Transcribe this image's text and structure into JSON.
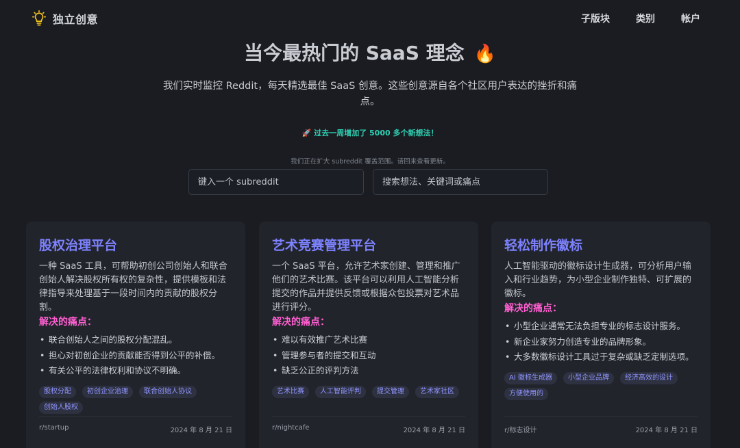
{
  "nav": {
    "brand": "独立创意",
    "links": [
      "子版块",
      "类别",
      "帐户"
    ]
  },
  "hero": {
    "title": "当今最热门的 SaaS 理念",
    "fire": "🔥",
    "subtitle": "我们实时监控 Reddit，每天精选最佳 SaaS 创意。这些创意源自各个社区用户表达的挫折和痛点。",
    "announce_icon": "🚀",
    "announce": "过去一周增加了 5000 多个新想法！",
    "expand_note": "我们正在扩大 subreddit 覆盖范围。请回来查看更新。"
  },
  "search": {
    "subreddit_placeholder": "键入一个 subreddit",
    "keyword_placeholder": "搜索想法、关键词或痛点"
  },
  "pain_heading": "解决的痛点：",
  "cards": [
    {
      "title": "股权治理平台",
      "description": "一种 SaaS 工具，可帮助初创公司创始人和联合创始人解决股权所有权的复杂性，提供模板和法律指导来处理基于一段时间内的贡献的股权分割。",
      "pains": [
        "联合创始人之间的股权分配混乱。",
        "担心对初创企业的贡献能否得到公平的补偿。",
        "有关公平的法律权利和协议不明确。"
      ],
      "tags": [
        "股权分配",
        "初创企业治理",
        "联合创始人协议",
        "创始人股权"
      ],
      "subreddit": "r/startup",
      "date": "2024 年 8 月 21 日"
    },
    {
      "title": "艺术竞赛管理平台",
      "description": "一个 SaaS 平台，允许艺术家创建、管理和推广他们的艺术比赛。该平台可以利用人工智能分析提交的作品并提供反馈或根据众包投票对艺术品进行评分。",
      "pains": [
        "难以有效推广艺术比赛",
        "管理参与者的提交和互动",
        "缺乏公正的评判方法"
      ],
      "tags": [
        "艺术比赛",
        "人工智能评判",
        "提交管理",
        "艺术家社区"
      ],
      "subreddit": "r/nightcafe",
      "date": "2024 年 8 月 21 日"
    },
    {
      "title": "轻松制作徽标",
      "description": "人工智能驱动的徽标设计生成器，可分析用户输入和行业趋势，为小型企业制作独特、可扩展的徽标。",
      "pains": [
        "小型企业通常无法负担专业的标志设计服务。",
        "新企业家努力创造专业的品牌形象。",
        "大多数徽标设计工具过于复杂或缺乏定制选项。"
      ],
      "tags": [
        "AI 徽标生成器",
        "小型企业品牌",
        "经济高效的设计",
        "方便使用的"
      ],
      "subreddit": "r/标志设计",
      "date": "2024 年 8 月 21 日"
    }
  ],
  "colors": {
    "background": "#1a1c22",
    "card": "#22242c",
    "title_accent": "#7d82ff",
    "pain_accent": "#ff5fd1",
    "announce": "#2fd0b2"
  },
  "icons": {
    "brand": "lightbulb-icon"
  }
}
